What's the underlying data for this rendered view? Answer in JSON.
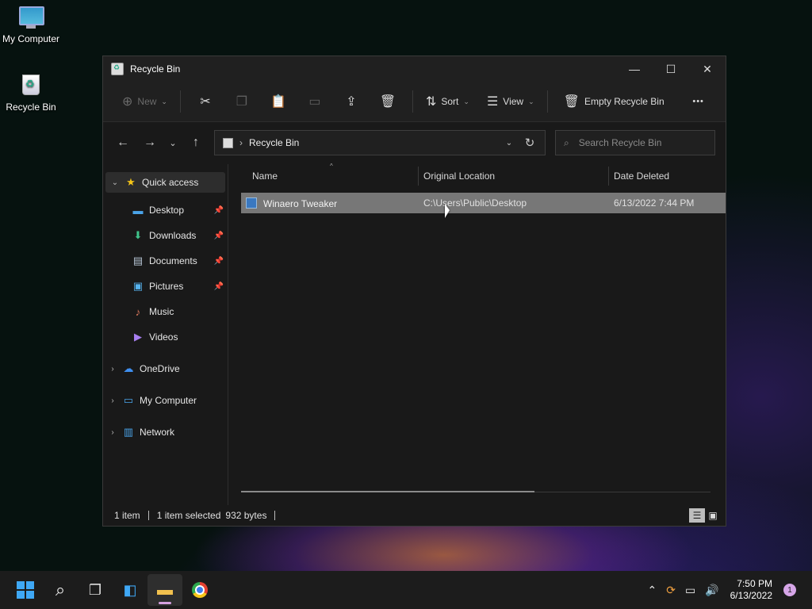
{
  "desktop": {
    "icons": [
      {
        "label": "My Computer"
      },
      {
        "label": "Recycle Bin"
      }
    ]
  },
  "window": {
    "title": "Recycle Bin",
    "controls": {
      "minimize": "—",
      "maximize": "☐",
      "close": "✕"
    }
  },
  "commandbar": {
    "new_label": "New",
    "sort_label": "Sort",
    "view_label": "View",
    "empty_label": "Empty Recycle Bin",
    "more": "•••"
  },
  "address": {
    "path": "Recycle Bin",
    "search_placeholder": "Search Recycle Bin"
  },
  "navpane": {
    "quick_access": "Quick access",
    "pinned": [
      {
        "label": "Desktop",
        "icon": "desktop-icon"
      },
      {
        "label": "Downloads",
        "icon": "downloads-icon"
      },
      {
        "label": "Documents",
        "icon": "documents-icon"
      },
      {
        "label": "Pictures",
        "icon": "pictures-icon"
      }
    ],
    "recent": [
      {
        "label": "Music",
        "icon": "music-icon"
      },
      {
        "label": "Videos",
        "icon": "videos-icon"
      }
    ],
    "onedrive": "OneDrive",
    "mycomputer": "My Computer",
    "network": "Network"
  },
  "columns": {
    "name": "Name",
    "location": "Original Location",
    "deleted": "Date Deleted"
  },
  "files": [
    {
      "name": "Winaero Tweaker",
      "location": "C:\\Users\\Public\\Desktop",
      "deleted": "6/13/2022 7:44 PM"
    }
  ],
  "status": {
    "count": "1 item",
    "selected": "1 item selected",
    "size": "932 bytes"
  },
  "taskbar": {
    "time": "7:50 PM",
    "date": "6/13/2022",
    "notifications": "1"
  },
  "colors": {
    "accent": "#3fa8f5",
    "selection": "#777777",
    "window_bg": "#191919"
  }
}
